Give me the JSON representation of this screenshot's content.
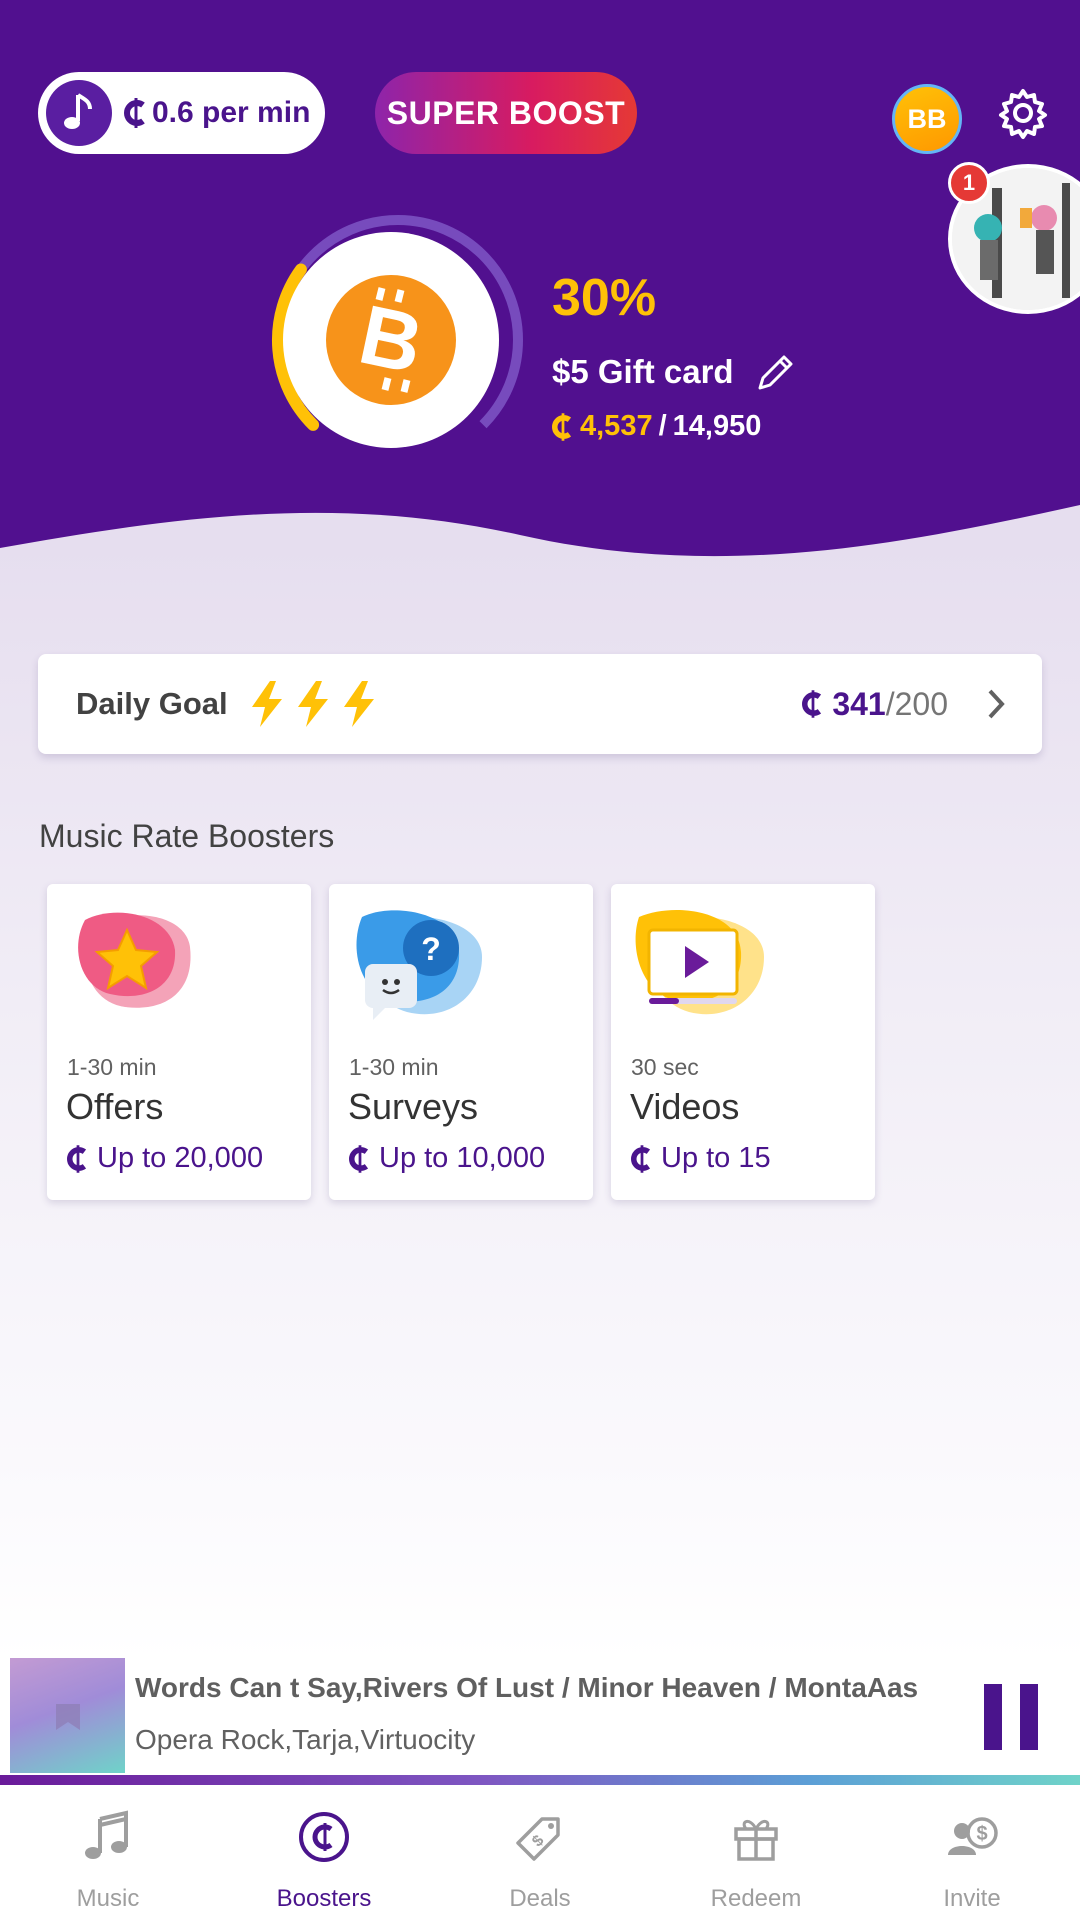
{
  "top_bar": {
    "rate_label": "0.6 per min",
    "super_boost_label": "SUPER BOOST",
    "avatar_initials": "BB",
    "notification_count": "1"
  },
  "progress": {
    "percent_label": "30%",
    "percent_value": 30,
    "goal_name": "$5 Gift card",
    "current": "4,537",
    "separator": "/",
    "target": "14,950"
  },
  "daily_goal": {
    "label": "Daily Goal",
    "current": "341",
    "target": "/200"
  },
  "boosters": {
    "title": "Music Rate Boosters",
    "items": [
      {
        "duration": "1-30 min",
        "name": "Offers",
        "reward": "Up to 20,000",
        "icon": "star-icon"
      },
      {
        "duration": "1-30 min",
        "name": "Surveys",
        "reward": "Up to 10,000",
        "icon": "survey-chat-icon"
      },
      {
        "duration": "30 sec",
        "name": "Videos",
        "reward": "Up to 15",
        "icon": "video-play-icon"
      }
    ]
  },
  "now_playing": {
    "title": "Words Can t Say,Rivers Of Lust / Minor Heaven / MontaAas",
    "artist": "Opera Rock,Tarja,Virtuocity"
  },
  "nav": {
    "items": [
      {
        "label": "Music",
        "icon": "music-note-icon",
        "active": false
      },
      {
        "label": "Boosters",
        "icon": "boosters-coin-icon",
        "active": true
      },
      {
        "label": "Deals",
        "icon": "deals-tag-icon",
        "active": false
      },
      {
        "label": "Redeem",
        "icon": "gift-icon",
        "active": false
      },
      {
        "label": "Invite",
        "icon": "invite-user-icon",
        "active": false
      }
    ]
  },
  "colors": {
    "primary": "#51108f",
    "accent_yellow": "#ffc107",
    "super_boost_start": "#8e24aa",
    "super_boost_end": "#e53935"
  }
}
